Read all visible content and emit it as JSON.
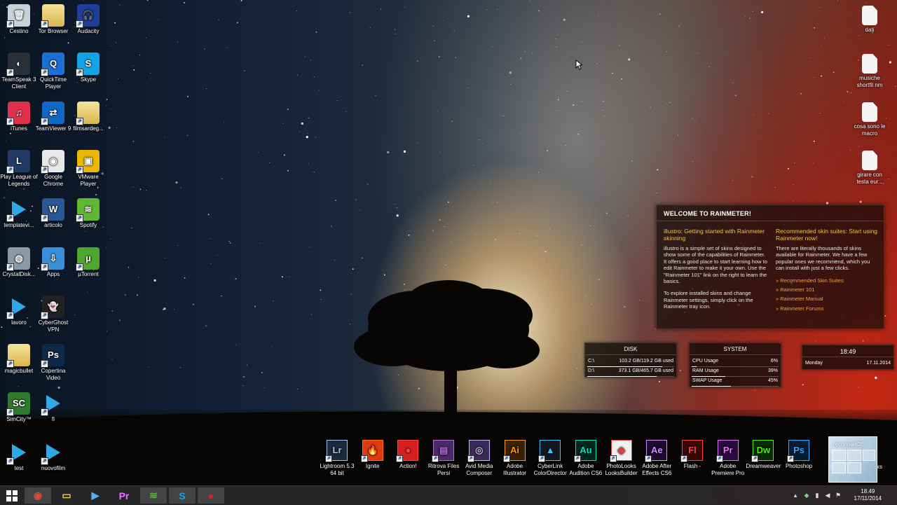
{
  "desktop": {
    "left_icons": [
      {
        "label": "Cestino",
        "icon": "recycle-bin-icon",
        "glyph": "🗑",
        "bg": "#c8d0d8"
      },
      {
        "label": "Tor Browser",
        "icon": "folder-icon",
        "glyph": "",
        "bg": "folder"
      },
      {
        "label": "Audacity",
        "icon": "audacity-icon",
        "glyph": "🎧",
        "bg": "#1f3f9a"
      },
      {
        "label": "TeamSpeak 3 Client",
        "icon": "teamspeak-icon",
        "glyph": "◐",
        "bg": "#2b2f38"
      },
      {
        "label": "QuickTime Player",
        "icon": "quicktime-icon",
        "glyph": "Q",
        "bg": "#1d6fd6"
      },
      {
        "label": "Skype",
        "icon": "skype-icon",
        "glyph": "S",
        "bg": "#12a5e6"
      },
      {
        "label": "iTunes",
        "icon": "itunes-icon",
        "glyph": "♫",
        "bg": "#e0304c"
      },
      {
        "label": "TeamViewer 9",
        "icon": "teamviewer-icon",
        "glyph": "⇄",
        "bg": "#1068c6"
      },
      {
        "label": "filmsardeg...",
        "icon": "folder-icon",
        "glyph": "",
        "bg": "folder"
      },
      {
        "label": "Play League of Legends",
        "icon": "league-icon",
        "glyph": "L",
        "bg": "#223a66"
      },
      {
        "label": "Google Chrome",
        "icon": "chrome-icon",
        "glyph": "◉",
        "bg": "#e8e8e8"
      },
      {
        "label": "VMware Player",
        "icon": "vmware-icon",
        "glyph": "▣",
        "bg": "#e9b900"
      },
      {
        "label": "templatevi...",
        "icon": "video-file-icon",
        "glyph": "",
        "bg": "play"
      },
      {
        "label": "articolo",
        "icon": "word-icon",
        "glyph": "W",
        "bg": "#2b5797"
      },
      {
        "label": "Spotify",
        "icon": "spotify-icon",
        "glyph": "≋",
        "bg": "#5fb832"
      },
      {
        "label": "CrystalDisk...",
        "icon": "crystaldisk-icon",
        "glyph": "◍",
        "bg": "#8a9aa6"
      },
      {
        "label": "Apps",
        "icon": "apps-icon",
        "glyph": "⇩",
        "bg": "#3a8fd8"
      },
      {
        "label": "µTorrent",
        "icon": "utorrent-icon",
        "glyph": "µ",
        "bg": "#4ea72e"
      },
      {
        "label": "lavoro",
        "icon": "video-file-icon",
        "glyph": "",
        "bg": "play"
      },
      {
        "label": "CyberGhost VPN",
        "icon": "cyberghost-icon",
        "glyph": "👻",
        "bg": "#222"
      },
      {
        "label": "magicbullet",
        "icon": "folder-icon",
        "glyph": "",
        "bg": "folder"
      },
      {
        "label": "Copertina Video",
        "icon": "psd-file-icon",
        "glyph": "Ps",
        "bg": "#0e2a4a"
      },
      {
        "label": "SimCity™",
        "icon": "simcity-icon",
        "glyph": "SC",
        "bg": "#2f7a2f"
      },
      {
        "label": "fi",
        "icon": "video-file-icon",
        "glyph": "",
        "bg": "play"
      },
      {
        "label": "test",
        "icon": "video-file-icon",
        "glyph": "",
        "bg": "play"
      },
      {
        "label": "nuovofilm",
        "icon": "video-file-icon",
        "glyph": "",
        "bg": "play"
      }
    ],
    "right_icons": [
      {
        "label": "dati",
        "icon": "text-file-icon"
      },
      {
        "label": "musiche shortfil nm",
        "icon": "text-file-icon"
      },
      {
        "label": "cosa sono le macro",
        "icon": "text-file-icon"
      },
      {
        "label": "girare con testa eur...",
        "icon": "text-file-icon"
      }
    ]
  },
  "rainmeter": {
    "welcome": {
      "title": "WELCOME TO RAINMETER!",
      "left_heading": "illustro: Getting started with Rainmeter skinning",
      "left_p1": "illustro is a simple set of skins designed to show some of the capabilities of Rainmeter. It offers a good place to start learning how to edit Rainmeter to make it your own. Use the \"Rainmeter 101\" link on the right to learn the basics.",
      "left_p2": "To explore installed skins and change Rainmeter settings, simply click on the Rainmeter tray icon.",
      "right_heading": "Recommended skin suites: Start using Rainmeter now!",
      "right_p1": "There are literally thousands of skins available for Rainmeter. We have a few popular ones we recommend, which you can install with just a few clicks.",
      "links": [
        "» Recommended Skin Suites",
        "» Rainmeter 101",
        "» Rainmeter Manual",
        "» Rainmeter Forums"
      ]
    },
    "disk": {
      "title": "DISK",
      "rows": [
        {
          "drive": "C:\\",
          "value": "103.2 GB/119.2 GB used",
          "fraction": 0.866
        },
        {
          "drive": "D:\\",
          "value": "373.1 GB/465.7 GB used",
          "fraction": 0.801
        }
      ]
    },
    "system": {
      "title": "SYSTEM",
      "rows": [
        {
          "name": "CPU Usage",
          "value": "6%",
          "fraction": 0.06
        },
        {
          "name": "RAM Usage",
          "value": "39%",
          "fraction": 0.39
        },
        {
          "name": "SWAP Usage",
          "value": "45%",
          "fraction": 0.45
        }
      ]
    },
    "clock": {
      "time": "18:49",
      "day": "Monday",
      "date": "17.11.2014"
    }
  },
  "app_row": [
    {
      "label": "Lightroom 5.3 64 bit",
      "glyph": "Lr",
      "color": "#9fc4e8",
      "bg": "#1b2a3a"
    },
    {
      "label": "Ignite",
      "glyph": "🔥",
      "color": "#ff6a1a",
      "bg": "#e23a10"
    },
    {
      "label": "Action!",
      "glyph": "●",
      "color": "#ff4040",
      "bg": "#d41f1f"
    },
    {
      "label": "Ritrova Files Persi",
      "glyph": "▤",
      "color": "#b070d0",
      "bg": "#4a2a6a"
    },
    {
      "label": "Avid Media Composer",
      "glyph": "◎",
      "color": "#c8b0f0",
      "bg": "#3a2a5a"
    },
    {
      "label": "Adobe Illustrator",
      "glyph": "Ai",
      "color": "#ff9a00",
      "bg": "#3a2000"
    },
    {
      "label": "CyberLink ColorDirector",
      "glyph": "▲",
      "color": "#40c0ff",
      "bg": "#101820"
    },
    {
      "label": "Adobe Audition CS6",
      "glyph": "Au",
      "color": "#00e4bb",
      "bg": "#00261f"
    },
    {
      "label": "PhotoLooks LooksBuilder",
      "glyph": "◆",
      "color": "#e04040",
      "bg": "#f0f0f0"
    },
    {
      "label": "Adobe After Effects CS6",
      "glyph": "Ae",
      "color": "#d291ff",
      "bg": "#1f0a30"
    },
    {
      "label": "Flash -",
      "glyph": "Fl",
      "color": "#ff4040",
      "bg": "#3a0606"
    },
    {
      "label": "Adobe Premiere Pro",
      "glyph": "Pr",
      "color": "#e077ff",
      "bg": "#2a0a3a"
    },
    {
      "label": "Dreamweaver",
      "glyph": "Dw",
      "color": "#4cf000",
      "bg": "#0a2a00"
    },
    {
      "label": "Photoshop",
      "glyph": "Ps",
      "color": "#31a8ff",
      "bg": "#001e36"
    }
  ],
  "app_row_partial": [
    {
      "label": "I"
    },
    {
      "label": "ks"
    }
  ],
  "thumbnail": {
    "title": "reconnaitCS"
  },
  "taskbar": {
    "items": [
      {
        "name": "chrome",
        "glyph": "◉",
        "color": "#e04a3a",
        "active": true
      },
      {
        "name": "file-explorer",
        "glyph": "▭",
        "color": "#f0c850",
        "active": false
      },
      {
        "name": "media-player",
        "glyph": "▶",
        "color": "#5ab0f0",
        "active": false
      },
      {
        "name": "premiere",
        "glyph": "Pr",
        "color": "#e077ff",
        "active": false
      },
      {
        "name": "spotify",
        "glyph": "≋",
        "color": "#5fb832",
        "active": true
      },
      {
        "name": "skype",
        "glyph": "S",
        "color": "#12a5e6",
        "active": true
      },
      {
        "name": "action-recorder",
        "glyph": "●",
        "color": "#e02020",
        "active": true
      }
    ],
    "clock_time": "18.49",
    "clock_date": "17/11/2014"
  }
}
